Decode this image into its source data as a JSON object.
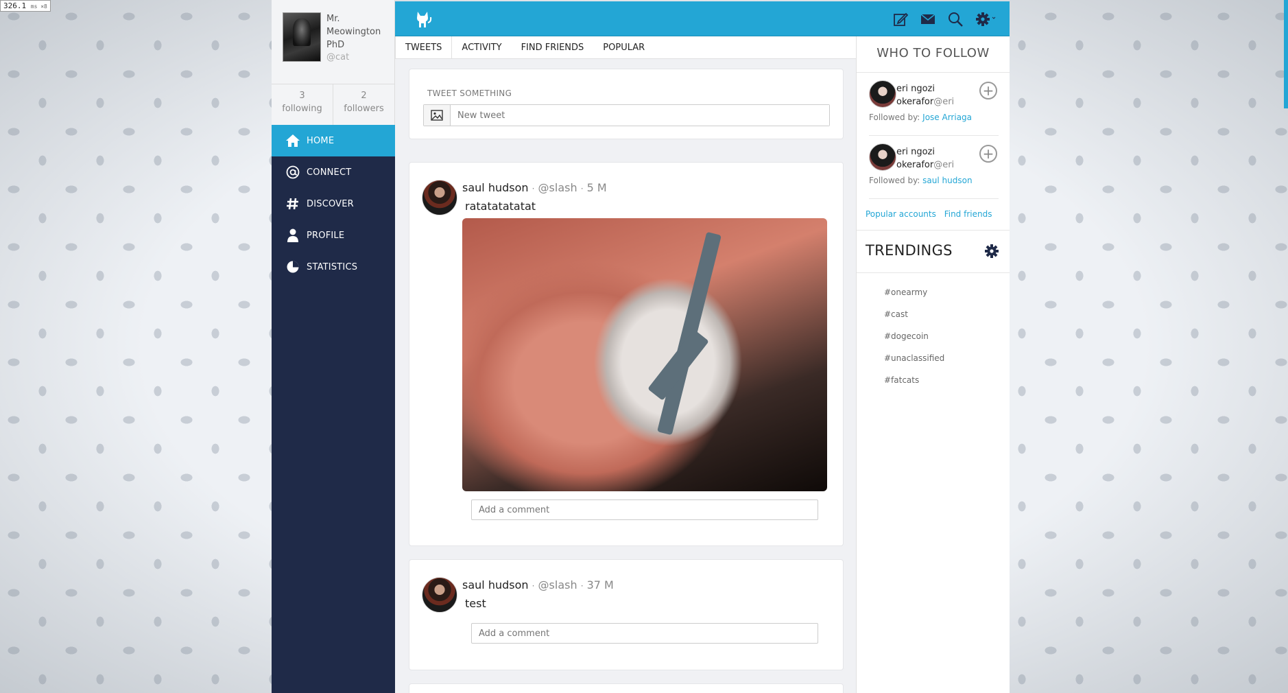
{
  "perf_badge": {
    "value": "326.1",
    "unit": "ms ×8"
  },
  "sidebar": {
    "profile": {
      "name_line1": "Mr.",
      "name_line2": "Meowington",
      "name_line3": "PhD",
      "handle": "@cat"
    },
    "stats": [
      {
        "count": "3",
        "label": "following"
      },
      {
        "count": "2",
        "label": "followers"
      }
    ],
    "nav": [
      {
        "label": "HOME",
        "icon": "home-icon",
        "active": true
      },
      {
        "label": "CONNECT",
        "icon": "at-icon"
      },
      {
        "label": "DISCOVER",
        "icon": "hash-icon"
      },
      {
        "label": "PROFILE",
        "icon": "user-icon"
      },
      {
        "label": "STATISTICS",
        "icon": "pie-chart-icon"
      }
    ]
  },
  "topbar": {
    "logo": "cat-logo-icon",
    "icons": [
      "compose-icon",
      "mail-icon",
      "search-icon",
      "gear-icon"
    ]
  },
  "tabs": [
    "TWEETS",
    "ACTIVITY",
    "FIND FRIENDS",
    "POPULAR"
  ],
  "compose": {
    "label": "TWEET SOMETHING",
    "placeholder": "New tweet"
  },
  "tweets": [
    {
      "name": "saul hudson",
      "handle": "@slash",
      "time": "5 M",
      "text": "ratatatatatat",
      "has_image": true,
      "comment_placeholder": "Add a comment"
    },
    {
      "name": "saul hudson",
      "handle": "@slash",
      "time": "37 M",
      "text": "test",
      "has_image": false,
      "comment_placeholder": "Add a comment"
    }
  ],
  "who_to_follow": {
    "title": "WHO TO FOLLOW",
    "items": [
      {
        "name1": "eri ngozi",
        "name2": "okerafor",
        "handle": "@eri",
        "followed_by_label": "Followed by:",
        "followed_by": "Jose Arriaga"
      },
      {
        "name1": "eri ngozi",
        "name2": "okerafor",
        "handle": "@eri",
        "followed_by_label": "Followed by:",
        "followed_by": "saul hudson"
      }
    ],
    "links": [
      "Popular accounts",
      "Find friends"
    ]
  },
  "trendings": {
    "title": "TRENDINGS",
    "items": [
      "#onearmy",
      "#cast",
      "#dogecoin",
      "#unaclassified",
      "#fatcats"
    ]
  },
  "colors": {
    "accent": "#23a6d5",
    "sidebar": "#1f2a48"
  }
}
